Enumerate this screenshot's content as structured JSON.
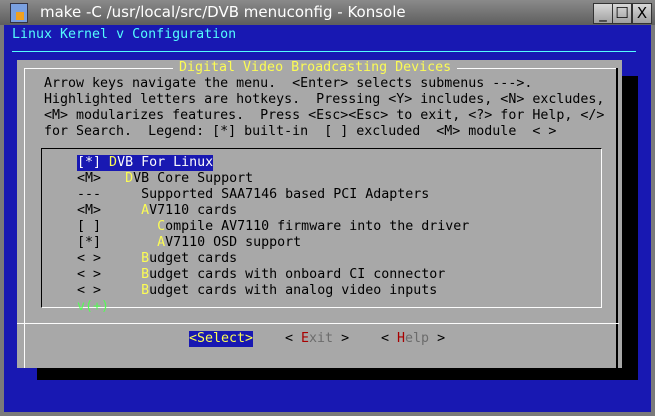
{
  "window": {
    "title": "make -C /usr/local/src/DVB menuconfig - Konsole",
    "buttons": [
      "_",
      "☐",
      "X"
    ]
  },
  "header": {
    "title": "Linux Kernel v Configuration"
  },
  "dialog": {
    "title": "Digital Video Broadcasting Devices",
    "help": [
      "Arrow keys navigate the menu.  <Enter> selects submenus --->.",
      "Highlighted letters are hotkeys.  Pressing <Y> includes, <N> excludes,",
      "<M> modularizes features.  Press <Esc><Esc> to exit, <?> for Help, </>",
      "for Search.  Legend: [*] built-in  [ ] excluded  <M> module  < >"
    ],
    "items": [
      {
        "state": "[*]",
        "indent": " ",
        "hotkey": "D",
        "label": "VB For Linux",
        "selected": true
      },
      {
        "state": "<M>",
        "indent": "   ",
        "hotkey": "D",
        "label": "VB Core Support"
      },
      {
        "state": "---",
        "indent": "     ",
        "hotkey": "",
        "label": "Supported SAA7146 based PCI Adapters"
      },
      {
        "state": "<M>",
        "indent": "     ",
        "hotkey": "A",
        "label": "V7110 cards"
      },
      {
        "state": "[ ]",
        "indent": "       ",
        "hotkey": "C",
        "label": "ompile AV7110 firmware into the driver"
      },
      {
        "state": "[*]",
        "indent": "       ",
        "hotkey": "A",
        "label": "V7110 OSD support"
      },
      {
        "state": "< >",
        "indent": "     ",
        "hotkey": "B",
        "label": "udget cards"
      },
      {
        "state": "< >",
        "indent": "     ",
        "hotkey": "B",
        "label": "udget cards with onboard CI connector"
      },
      {
        "state": "< >",
        "indent": "     ",
        "hotkey": "B",
        "label": "udget cards with analog video inputs"
      }
    ],
    "more_indicator": "v(+)",
    "buttons": {
      "select": "<Select>",
      "exit_left": "< ",
      "exit_hot": "E",
      "exit_rest": "xit",
      " exit_right": " >",
      "help_left": "< ",
      "help_hot": "H",
      "help_rest": "elp",
      "help_right": " >",
      "exit_right": " >"
    }
  },
  "colors": {
    "background": "#1818b2",
    "dialog": "#a8a8a8",
    "title": "#54fcfc",
    "hotkey": "#fcfc54"
  }
}
